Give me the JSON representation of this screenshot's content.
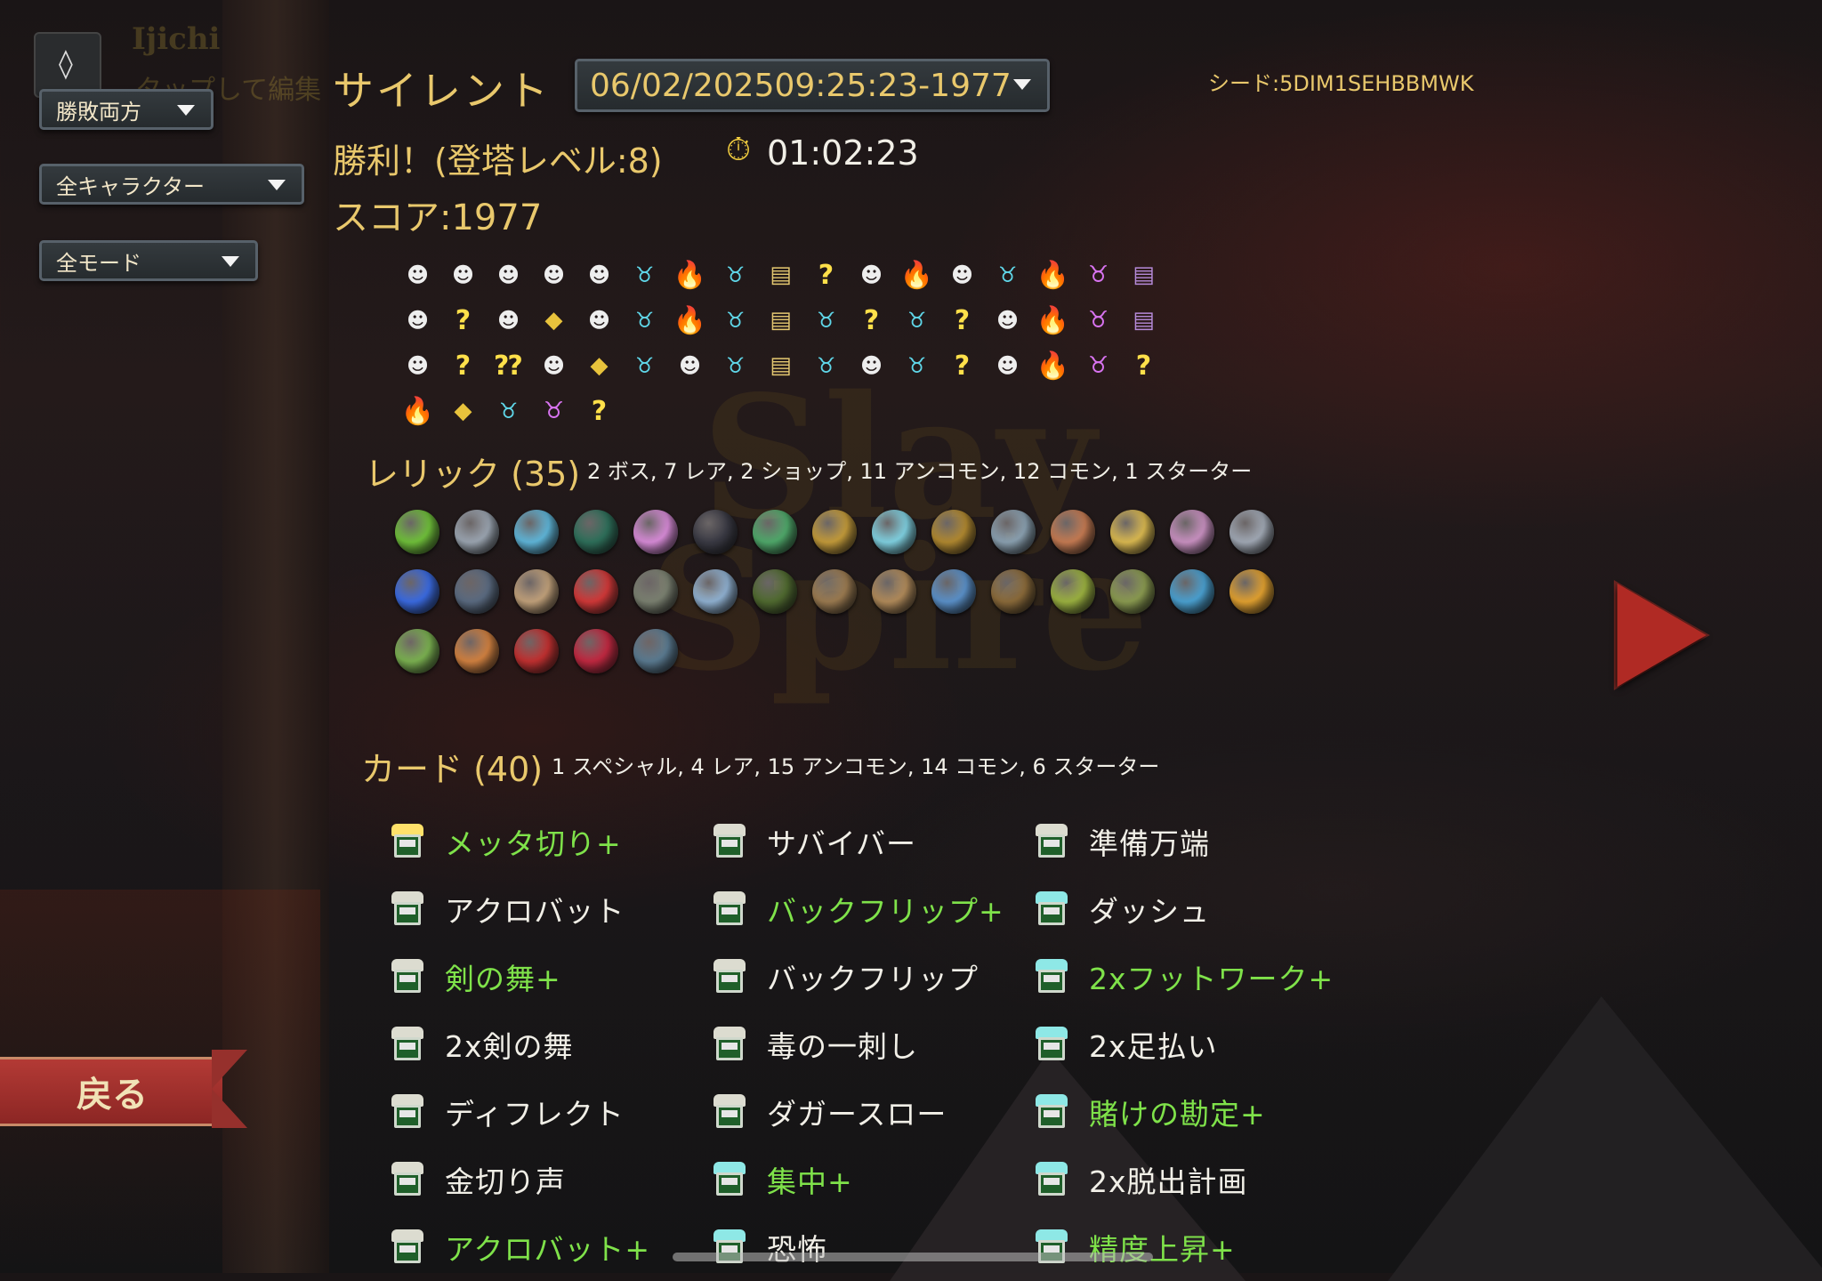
{
  "header": {
    "ghost_user": "Ijichi",
    "ghost_hint": "タップして編集",
    "character": "サイレント",
    "run_select": "06/02/202509:25:23-1977",
    "seed": "シード:5DIM1SEHBBMWK",
    "result": "勝利！(登塔レベル:8)",
    "time": "01:02:23",
    "score": "スコア:1977"
  },
  "filters": {
    "outcome": "勝敗両方",
    "character": "全キャラクター",
    "mode": "全モード"
  },
  "map_path": {
    "rows": [
      [
        "monster",
        "monster",
        "monster",
        "monster",
        "monster",
        "elite",
        "fire",
        "elite",
        "chest",
        "unknown",
        "monster",
        "fire",
        "monster",
        "elite",
        "fire",
        "boss",
        "shop"
      ],
      [
        "monster",
        "unknown",
        "monster",
        "gold",
        "monster",
        "elite",
        "fire",
        "elite",
        "chest",
        "elite",
        "unknown",
        "elite",
        "unknown",
        "monster",
        "fire",
        "boss",
        "shop"
      ],
      [
        "monster",
        "unknown",
        "unknown-monster",
        "monster",
        "gold",
        "elite",
        "monster",
        "elite",
        "chest",
        "elite",
        "monster",
        "elite",
        "unknown",
        "monster",
        "fire",
        "boss",
        "unknown"
      ],
      [
        "fire",
        "gold",
        "elite",
        "boss",
        "unknown"
      ]
    ],
    "glyphs": {
      "monster": "☻",
      "elite": "♉",
      "fire": "🔥",
      "chest": "▤",
      "unknown": "?",
      "gold": "◆",
      "boss": "♉",
      "shop": "▤",
      "unknown-monster": "⁇"
    }
  },
  "relics": {
    "title": "レリック (35)",
    "summary": "2 ボス, 7 レア, 2 ショップ, 11 アンコモン, 12 コモン, 1 スターター",
    "items": [
      [
        "#6fbf3a",
        "#9aa4b0",
        "#5fb5d8",
        "#2e6f5a",
        "#d68ad6",
        "#3a3a44",
        "#4fa86a",
        "#c29a3a",
        "#7fd0e0",
        "#b08830",
        "#8aa0b0",
        "#c47a52",
        "#d9b850",
        "#c890c0",
        "#a0a8b4"
      ],
      [
        "#3a6ae0",
        "#5a6a80",
        "#c0a07a",
        "#d03838",
        "#7a8070",
        "#8fb0d0",
        "#506a30",
        "#9a7a50",
        "#b08a5a",
        "#5a90c8",
        "#8a6a3a",
        "#9ab040",
        "#8a9a50",
        "#4aa0d0",
        "#e0a030"
      ],
      [
        "#7ab050",
        "#d08040",
        "#c03030",
        "#c02840",
        "#5a7a90"
      ]
    ]
  },
  "cards": {
    "title": "カード (40)",
    "summary": "1 スペシャル, 4 レア, 15 アンコモン, 14 コモン, 6 スターター",
    "columns": [
      [
        {
          "name": "メッタ切り+",
          "upgraded": true,
          "rarity": "gold"
        },
        {
          "name": "アクロバット",
          "upgraded": false,
          "rarity": "common"
        },
        {
          "name": "剣の舞+",
          "upgraded": true,
          "rarity": "common"
        },
        {
          "name": "2x剣の舞",
          "upgraded": false,
          "rarity": "common"
        },
        {
          "name": "ディフレクト",
          "upgraded": false,
          "rarity": "common"
        },
        {
          "name": "金切り声",
          "upgraded": false,
          "rarity": "common"
        },
        {
          "name": "アクロバット+",
          "upgraded": true,
          "rarity": "common"
        }
      ],
      [
        {
          "name": "サバイバー",
          "upgraded": false,
          "rarity": "common"
        },
        {
          "name": "バックフリップ+",
          "upgraded": true,
          "rarity": "common"
        },
        {
          "name": "バックフリップ",
          "upgraded": false,
          "rarity": "common"
        },
        {
          "name": "毒の一刺し",
          "upgraded": false,
          "rarity": "common"
        },
        {
          "name": "ダガースロー",
          "upgraded": false,
          "rarity": "common"
        },
        {
          "name": "集中+",
          "upgraded": true,
          "rarity": "teal"
        },
        {
          "name": "恐怖",
          "upgraded": false,
          "rarity": "teal"
        }
      ],
      [
        {
          "name": "準備万端",
          "upgraded": false,
          "rarity": "common"
        },
        {
          "name": "ダッシュ",
          "upgraded": false,
          "rarity": "teal"
        },
        {
          "name": "2xフットワーク+",
          "upgraded": true,
          "rarity": "teal"
        },
        {
          "name": "2x足払い",
          "upgraded": false,
          "rarity": "teal"
        },
        {
          "name": "賭けの勘定+",
          "upgraded": true,
          "rarity": "teal"
        },
        {
          "name": "2x脱出計画",
          "upgraded": false,
          "rarity": "teal"
        },
        {
          "name": "精度上昇+",
          "upgraded": true,
          "rarity": "teal"
        }
      ]
    ]
  },
  "nav": {
    "back_label": "戻る"
  },
  "colors": {
    "gold_text": "#e9c86c",
    "upgraded_card": "#7fe24a",
    "normal_card": "#f1efe7",
    "back_button": "#b33a35"
  }
}
